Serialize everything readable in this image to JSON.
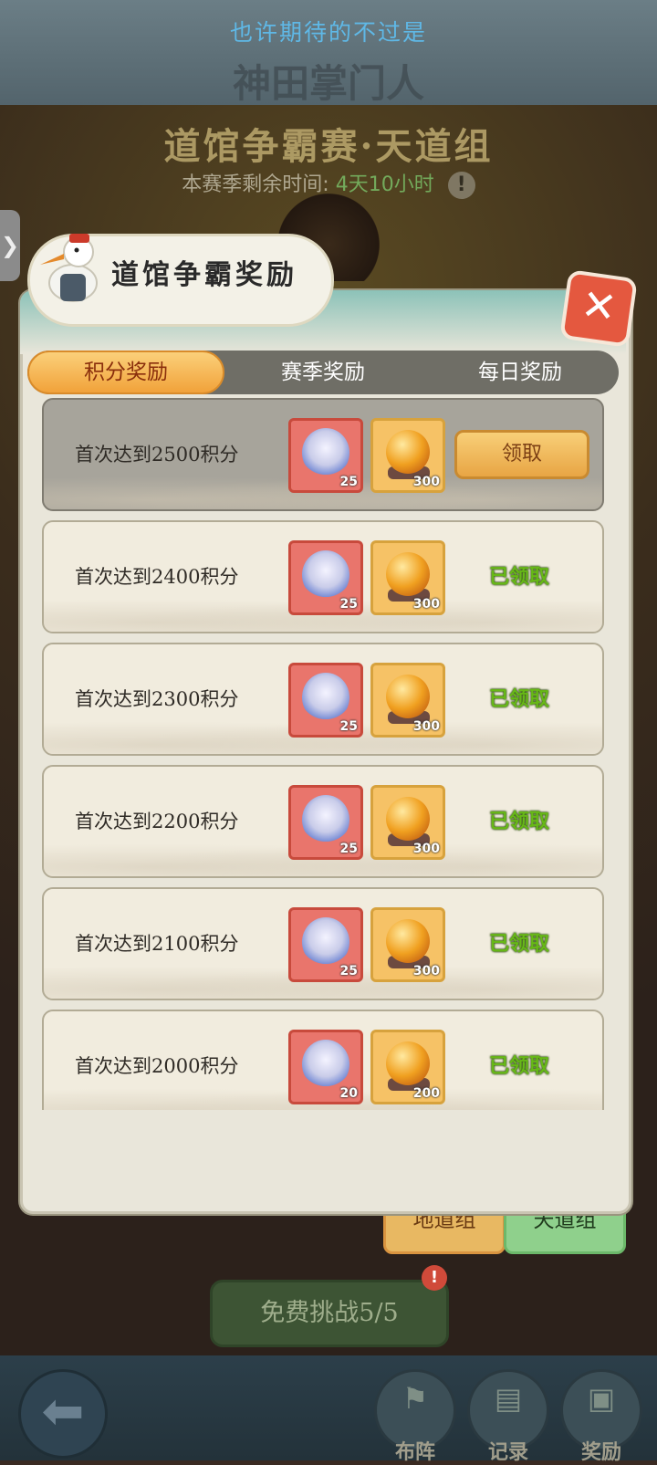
{
  "banner": {
    "slogan": "也许期待的不过是",
    "logo_text": "神田掌门人"
  },
  "event": {
    "title": "道馆争霸赛·天道组",
    "season_label": "本赛季剩余时间:",
    "season_time": "4天10小时",
    "info_icon": "!"
  },
  "modal": {
    "title": "道馆争霸奖励",
    "close_glyph": "✕",
    "tabs": [
      {
        "label": "积分奖励",
        "active": true
      },
      {
        "label": "赛季奖励",
        "active": false
      },
      {
        "label": "每日奖励",
        "active": false
      }
    ],
    "rows": [
      {
        "label": "首次达到2500积分",
        "hero_qty": "25",
        "orb_qty": "300",
        "status": "claimable",
        "action_label": "领取"
      },
      {
        "label": "首次达到2400积分",
        "hero_qty": "25",
        "orb_qty": "300",
        "status": "claimed",
        "action_label": "已领取"
      },
      {
        "label": "首次达到2300积分",
        "hero_qty": "25",
        "orb_qty": "300",
        "status": "claimed",
        "action_label": "已领取"
      },
      {
        "label": "首次达到2200积分",
        "hero_qty": "25",
        "orb_qty": "300",
        "status": "claimed",
        "action_label": "已领取"
      },
      {
        "label": "首次达到2100积分",
        "hero_qty": "25",
        "orb_qty": "300",
        "status": "claimed",
        "action_label": "已领取"
      },
      {
        "label": "首次达到2000积分",
        "hero_qty": "20",
        "orb_qty": "200",
        "status": "claimed",
        "action_label": "已领取"
      }
    ]
  },
  "groups": {
    "earth": "地道组",
    "sky": "天道组"
  },
  "challenge": {
    "label": "免费挑战5/5",
    "badge": "!"
  },
  "nav": {
    "back_glyph": "⬅",
    "formation": "布阵",
    "records": "记录",
    "rewards": "奖励"
  },
  "colors": {
    "accent_orange": "#f1a23a",
    "claimed_green": "#67b817",
    "close_red": "#e4583f"
  }
}
